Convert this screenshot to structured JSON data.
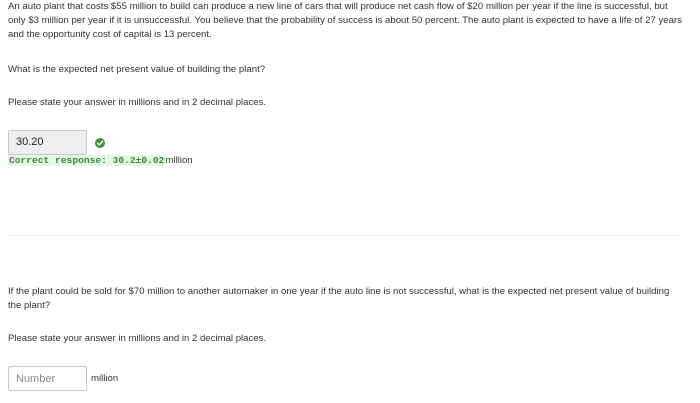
{
  "question1": {
    "intro": "An auto plant that costs $55 million to build can produce a new line of cars that will produce net cash flow of $20 million per year if the line is successful, but only $3 million per year if it is unsuccessful. You believe that the probability of success is about 50 percent. The auto plant is expected to have a life of 27 years and the opportunity cost of capital is 13 percent.",
    "question": "What is the expected net present value of building the plant?",
    "instruction": "Please state your answer in millions and in 2 decimal places.",
    "answer_value": "30.20",
    "feedback": "Correct response: 30.2±0.02",
    "feedback_unit": "million",
    "check_icon_color": "#3a9a3a"
  },
  "question2": {
    "question": "If the plant could be sold for $70 million to another automaker in one year if the auto line is not successful, what is the expected net present value of building the plant?",
    "instruction": "Please state your answer in millions and in 2 decimal places.",
    "answer_placeholder": "Number",
    "unit": "million"
  }
}
